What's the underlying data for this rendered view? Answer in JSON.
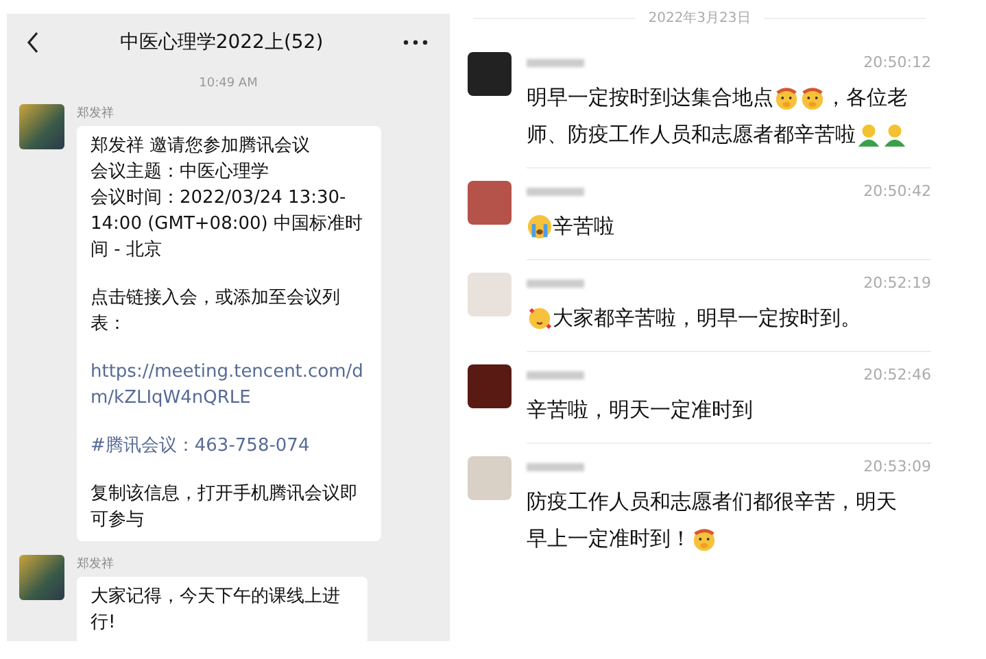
{
  "left_chat": {
    "title": "中医心理学2022上(52)",
    "timestamp": "10:49 AM",
    "messages": [
      {
        "sender": "郑发祥",
        "paragraphs": [
          {
            "kind": "text",
            "lines": [
              "郑发祥 邀请您参加腾讯会议",
              "会议主题：中医心理学",
              "会议时间：2022/03/24 13:30-14:00 (GMT+08:00) 中国标准时间 - 北京"
            ]
          },
          {
            "kind": "text",
            "lines": [
              "点击链接入会，或添加至会议列表："
            ]
          },
          {
            "kind": "link",
            "lines": [
              "https://meeting.tencent.com/dm/kZLIqW4nQRLE"
            ]
          },
          {
            "kind": "link",
            "lines": [
              "#腾讯会议：463-758-074"
            ]
          },
          {
            "kind": "text",
            "lines": [
              "复制该信息，打开手机腾讯会议即可参与"
            ]
          }
        ]
      },
      {
        "sender": "郑发祥",
        "paragraphs": [
          {
            "kind": "text",
            "lines": [
              "大家记得，今天下午的课线上进行!"
            ]
          }
        ]
      }
    ]
  },
  "right_chat": {
    "date": "2022年3月23日",
    "messages": [
      {
        "time": "20:50:12",
        "lines": [
          [
            {
              "kind": "text",
              "text": "明早一定按时到达集合地点"
            },
            {
              "kind": "emoji"
            },
            {
              "kind": "emoji"
            },
            {
              "kind": "text",
              "text": "，各位老"
            }
          ],
          [
            {
              "kind": "text",
              "text": "师、防疫工作人员和志愿者都辛苦啦"
            },
            {
              "kind": "figure"
            },
            {
              "kind": "figure"
            }
          ]
        ]
      },
      {
        "time": "20:50:42",
        "lines": [
          [
            {
              "kind": "crying"
            },
            {
              "kind": "text",
              "text": "辛苦啦"
            }
          ]
        ]
      },
      {
        "time": "20:52:19",
        "lines": [
          [
            {
              "kind": "hearts"
            },
            {
              "kind": "text",
              "text": "大家都辛苦啦，明早一定按时到。"
            }
          ]
        ]
      },
      {
        "time": "20:52:46",
        "lines": [
          [
            {
              "kind": "text",
              "text": "辛苦啦，明天一定准时到"
            }
          ]
        ]
      },
      {
        "time": "20:53:09",
        "lines": [
          [
            {
              "kind": "text",
              "text": "防疫工作人员和志愿者们都很辛苦，明天"
            }
          ],
          [
            {
              "kind": "text",
              "text": "早上一定准时到！"
            },
            {
              "kind": "emoji"
            }
          ]
        ]
      }
    ]
  }
}
